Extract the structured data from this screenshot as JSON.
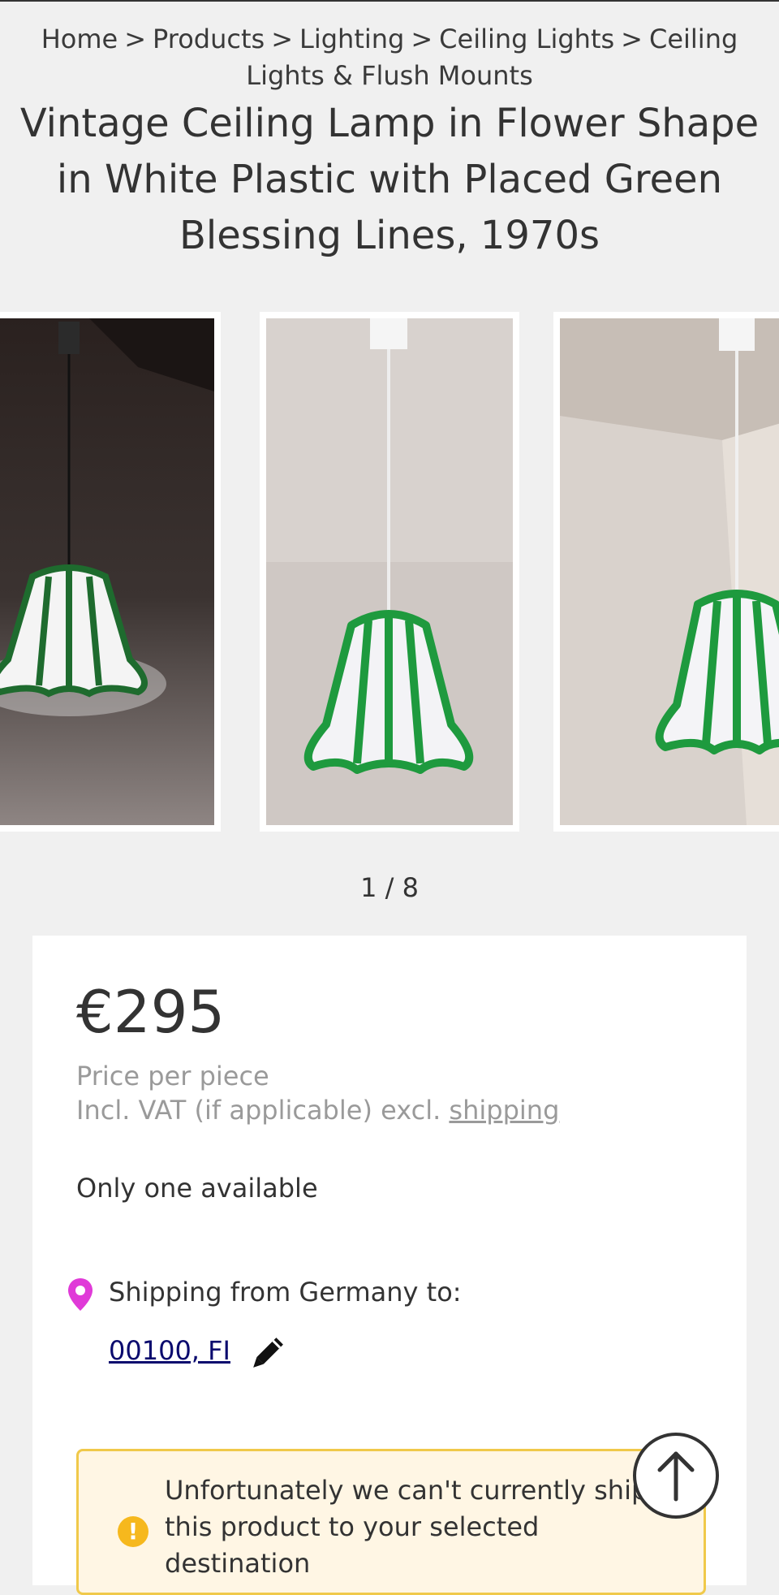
{
  "breadcrumb": {
    "items": [
      "Home",
      "Products",
      "Lighting",
      "Ceiling Lights",
      "Ceiling Lights & Flush Mounts"
    ],
    "separator": ">"
  },
  "product": {
    "title": "Vintage Ceiling Lamp in Flower Shape in White Plastic with Placed Green Blessing Lines, 1970s",
    "gallery_counter": "1 / 8",
    "price": "€295",
    "price_unit": "Price per piece",
    "price_vat_text": "Incl. VAT (if applicable) excl.",
    "shipping_link": "shipping",
    "availability": "Only one available"
  },
  "shipping": {
    "from_text": "Shipping from Germany to:",
    "postal_code": "00100, FI"
  },
  "notice": {
    "icon": "!",
    "text": "Unfortunately we can't currently ship this product to your selected destination"
  },
  "colors": {
    "lamp_green": "#1e9a3e",
    "pin_magenta": "#e03ad8",
    "notice_border": "#f0c94a",
    "notice_bg": "#fff6e4"
  },
  "icons": {
    "pin": "location-pin-icon",
    "pencil": "pencil-icon",
    "scroll_top": "arrow-up-icon",
    "notice": "exclamation-icon"
  }
}
